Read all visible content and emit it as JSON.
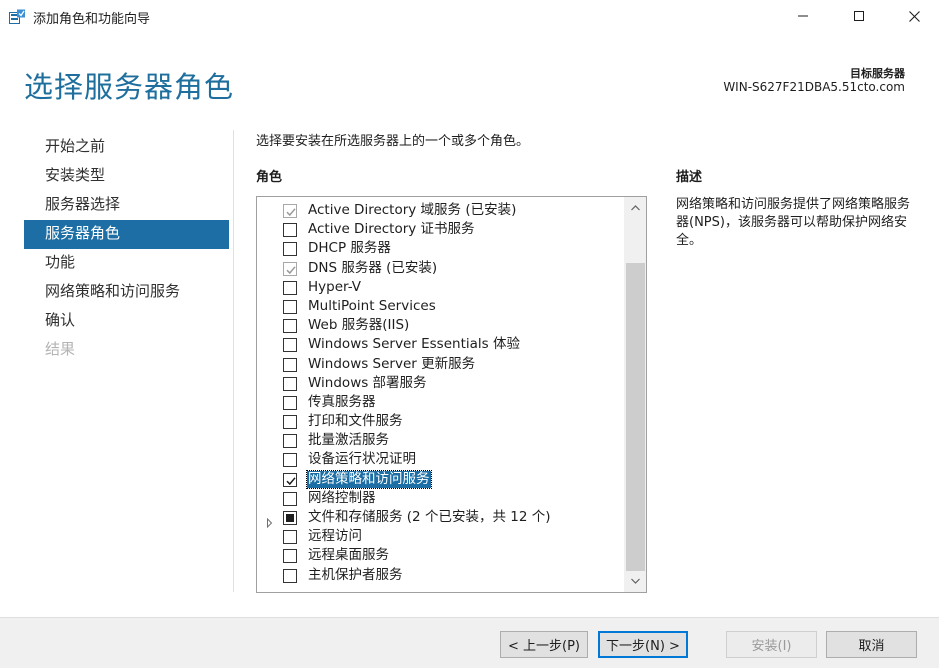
{
  "window": {
    "title": "添加角色和功能向导",
    "icon": "server-wizard-icon"
  },
  "header": {
    "page_title": "选择服务器角色",
    "target_label": "目标服务器",
    "target_value": "WIN-S627F21DBA5.51cto.com"
  },
  "nav": {
    "items": [
      {
        "label": "开始之前",
        "state": "normal"
      },
      {
        "label": "安装类型",
        "state": "normal"
      },
      {
        "label": "服务器选择",
        "state": "normal"
      },
      {
        "label": "服务器角色",
        "state": "selected"
      },
      {
        "label": "功能",
        "state": "normal"
      },
      {
        "label": "网络策略和访问服务",
        "state": "normal"
      },
      {
        "label": "确认",
        "state": "normal"
      },
      {
        "label": "结果",
        "state": "disabled"
      }
    ]
  },
  "main": {
    "instruction": "选择要安装在所选服务器上的一个或多个角色。",
    "roles_heading": "角色",
    "description_heading": "描述",
    "description_text": "网络策略和访问服务提供了网络策略服务器(NPS)，该服务器可以帮助保护网络安全。",
    "roles": [
      {
        "label": "Active Directory 域服务 (已安装)",
        "state": "installed"
      },
      {
        "label": "Active Directory 证书服务",
        "state": "unchecked"
      },
      {
        "label": "DHCP 服务器",
        "state": "unchecked"
      },
      {
        "label": "DNS 服务器 (已安装)",
        "state": "installed"
      },
      {
        "label": "Hyper-V",
        "state": "unchecked"
      },
      {
        "label": "MultiPoint Services",
        "state": "unchecked"
      },
      {
        "label": "Web 服务器(IIS)",
        "state": "unchecked"
      },
      {
        "label": "Windows Server Essentials 体验",
        "state": "unchecked"
      },
      {
        "label": "Windows Server 更新服务",
        "state": "unchecked"
      },
      {
        "label": "Windows 部署服务",
        "state": "unchecked"
      },
      {
        "label": "传真服务器",
        "state": "unchecked"
      },
      {
        "label": "打印和文件服务",
        "state": "unchecked"
      },
      {
        "label": "批量激活服务",
        "state": "unchecked"
      },
      {
        "label": "设备运行状况证明",
        "state": "unchecked"
      },
      {
        "label": "网络策略和访问服务",
        "state": "checked",
        "selected": true
      },
      {
        "label": "网络控制器",
        "state": "unchecked"
      },
      {
        "label": "文件和存储服务 (2 个已安装，共 12 个)",
        "state": "indeterminate",
        "expandable": true
      },
      {
        "label": "远程访问",
        "state": "unchecked"
      },
      {
        "label": "远程桌面服务",
        "state": "unchecked"
      },
      {
        "label": "主机保护者服务",
        "state": "unchecked"
      }
    ]
  },
  "footer": {
    "prev_label": "< 上一步(P)",
    "next_label": "下一步(N) >",
    "install_label": "安装(I)",
    "cancel_label": "取消"
  },
  "colors": {
    "accent": "#1c6ea4",
    "title": "#1e6f9e",
    "footer_bg": "#f0f0f0"
  }
}
